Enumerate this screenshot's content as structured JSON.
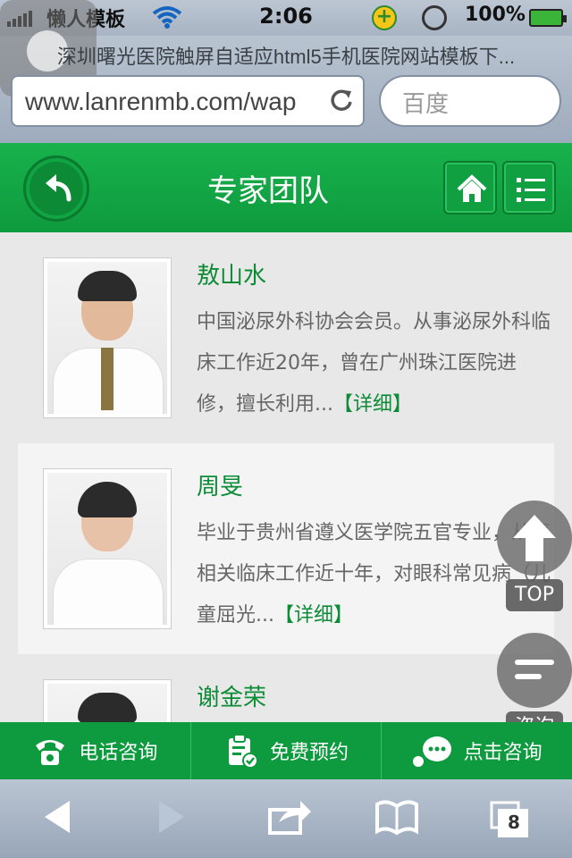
{
  "status_bar": {
    "carrier": "懒人模板",
    "time": "2:06",
    "battery": "100%"
  },
  "browser": {
    "page_title": "深圳曙光医院触屏自适应html5手机医院网站模板下...",
    "url": "www.lanrenmb.com/wap",
    "search_placeholder": "百度",
    "tab_count": "8"
  },
  "header": {
    "title": "专家团队"
  },
  "doctors": [
    {
      "name": "敖山水",
      "desc": "中国泌尿外科协会会员。从事泌尿外科临床工作近20年，曾在广州珠江医院进修，擅长利用...",
      "more": "【详细】"
    },
    {
      "name": "周旻",
      "desc": "毕业于贵州省遵义医学院五官专业，从事相关临床工作近十年，对眼科常见病（儿童屈光...",
      "more": "【详细】"
    },
    {
      "name": "谢金荣",
      "desc": "",
      "more": ""
    }
  ],
  "floating": {
    "top_label": "TOP",
    "chat_label": "咨询"
  },
  "consult_bar": {
    "phone": "电话咨询",
    "appointment": "免费预约",
    "online": "点击咨询"
  },
  "colors": {
    "brand_green": "#0e9a3e",
    "name_green": "#0d8b36"
  }
}
